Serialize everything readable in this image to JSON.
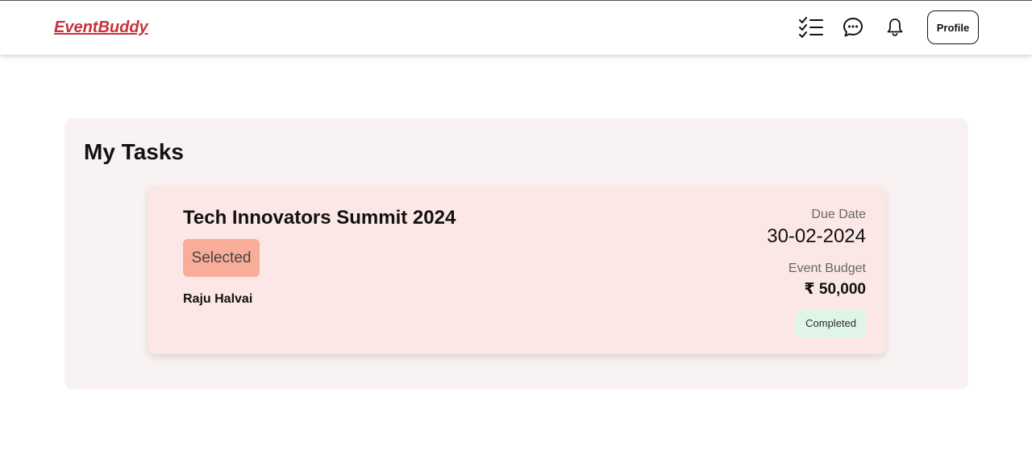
{
  "navbar": {
    "brand": "EventBuddy",
    "icons": [
      "tasks-icon",
      "chat-icon",
      "bell-icon"
    ],
    "profile_label": "Profile"
  },
  "main": {
    "title": "My Tasks",
    "tasks": [
      {
        "title": "Tech Innovators Summit 2024",
        "selection_status": "Selected",
        "person": "Raju Halvai",
        "due_label": "Due Date",
        "due_date": "30-02-2024",
        "budget_label": "Event Budget",
        "budget": "₹ 50,000",
        "status": "Completed"
      }
    ]
  },
  "colors": {
    "brand": "#c8323a",
    "panel_bg": "#f8f3f2",
    "card_bg": "#fbe8e6",
    "selected_badge": "#f8ad99",
    "completed_badge": "#dff5e8"
  }
}
